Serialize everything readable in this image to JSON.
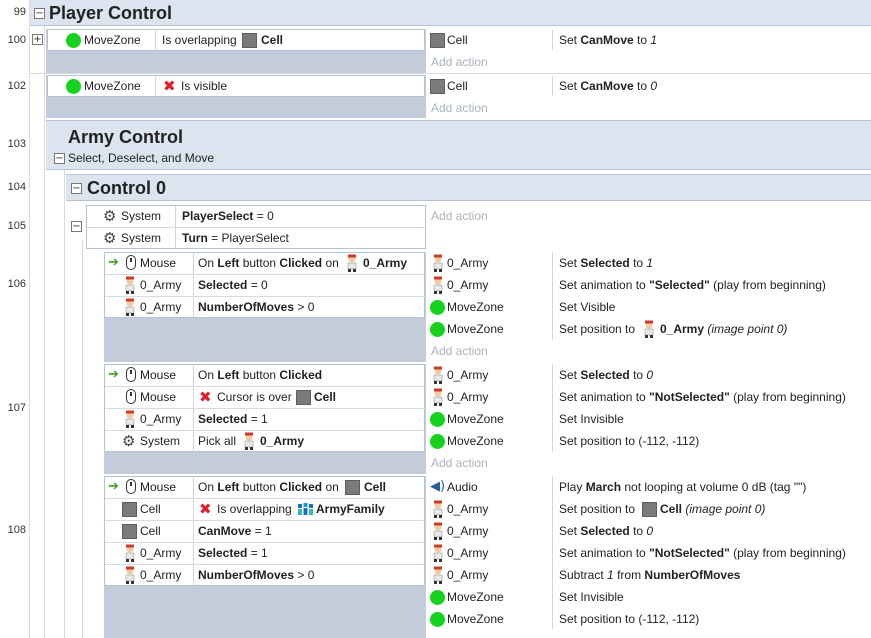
{
  "line_numbers": [
    "99",
    "100",
    "102",
    "103",
    "104",
    "105",
    "106",
    "107",
    "108"
  ],
  "expand_glyphs": {
    "plus": "+",
    "minus": "−"
  },
  "add_action": "Add action",
  "group_player": {
    "title": "Player Control"
  },
  "ev100": {
    "c1_obj": "MoveZone",
    "c1_text": "Is overlapping",
    "c1_target": "Cell",
    "a1_obj": "Cell",
    "a1_pre": "Set",
    "a1_var": "CanMove",
    "a1_mid": "to",
    "a1_val": "1"
  },
  "ev102": {
    "c1_obj": "MoveZone",
    "c1_text": "Is visible",
    "a1_obj": "Cell",
    "a1_pre": "Set",
    "a1_var": "CanMove",
    "a1_mid": "to",
    "a1_val": "0"
  },
  "group_army": {
    "title": "Army Control",
    "description": "Select, Deselect, and Move"
  },
  "group_control0": {
    "title": "Control 0"
  },
  "ev105": {
    "c1_obj": "System",
    "c1_var": "PlayerSelect",
    "c1_rest": "= 0",
    "c2_obj": "System",
    "c2_var": "Turn",
    "c2_rest": "= PlayerSelect"
  },
  "ev106": {
    "c1_obj": "Mouse",
    "c1_pre": "On",
    "c1_btn": "Left",
    "c1_mid": "button",
    "c1_act": "Clicked",
    "c1_on": "on",
    "c1_target": "0_Army",
    "c2_obj": "0_Army",
    "c2_var": "Selected",
    "c2_rest": "= 0",
    "c3_obj": "0_Army",
    "c3_var": "NumberOfMoves",
    "c3_rest": "> 0",
    "a1_obj": "0_Army",
    "a1_pre": "Set",
    "a1_var": "Selected",
    "a1_mid": "to",
    "a1_val": "1",
    "a2_obj": "0_Army",
    "a2_pre": "Set animation to",
    "a2_anim": "\"Selected\"",
    "a2_rest": "(play from beginning)",
    "a3_obj": "MoveZone",
    "a3_text": "Set Visible",
    "a4_obj": "MoveZone",
    "a4_pre": "Set position to",
    "a4_target": "0_Army",
    "a4_rest": "(image point 0)"
  },
  "ev107": {
    "c1_obj": "Mouse",
    "c1_pre": "On",
    "c1_btn": "Left",
    "c1_mid": "button",
    "c1_act": "Clicked",
    "c2_obj": "Mouse",
    "c2_text": "Cursor is over",
    "c2_target": "Cell",
    "c3_obj": "0_Army",
    "c3_var": "Selected",
    "c3_rest": "= 1",
    "c4_obj": "System",
    "c4_text": "Pick all",
    "c4_target": "0_Army",
    "a1_obj": "0_Army",
    "a1_pre": "Set",
    "a1_var": "Selected",
    "a1_mid": "to",
    "a1_val": "0",
    "a2_obj": "0_Army",
    "a2_pre": "Set animation to",
    "a2_anim": "\"NotSelected\"",
    "a2_rest": "(play from beginning)",
    "a3_obj": "MoveZone",
    "a3_text": "Set Invisible",
    "a4_obj": "MoveZone",
    "a4_text": "Set position to (-112, -112)"
  },
  "ev108": {
    "c1_obj": "Mouse",
    "c1_pre": "On",
    "c1_btn": "Left",
    "c1_mid": "button",
    "c1_act": "Clicked",
    "c1_on": "on",
    "c1_target": "Cell",
    "c2_obj": "Cell",
    "c2_text": "Is overlapping",
    "c2_target": "ArmyFamily",
    "c3_obj": "Cell",
    "c3_var": "CanMove",
    "c3_rest": "= 1",
    "c4_obj": "0_Army",
    "c4_var": "Selected",
    "c4_rest": "= 1",
    "c5_obj": "0_Army",
    "c5_var": "NumberOfMoves",
    "c5_rest": "> 0",
    "a1_obj": "Audio",
    "a1_pre": "Play",
    "a1_sound": "March",
    "a1_rest": "not looping at volume 0 dB (tag \"\")",
    "a2_obj": "0_Army",
    "a2_pre": "Set position to",
    "a2_target": "Cell",
    "a2_rest": "(image point 0)",
    "a3_obj": "0_Army",
    "a3_pre": "Set",
    "a3_var": "Selected",
    "a3_mid": "to",
    "a3_val": "0",
    "a4_obj": "0_Army",
    "a4_pre": "Set animation to",
    "a4_anim": "\"NotSelected\"",
    "a4_rest": "(play from beginning)",
    "a5_obj": "0_Army",
    "a5_pre": "Subtract",
    "a5_num": "1",
    "a5_mid": "from",
    "a5_var": "NumberOfMoves",
    "a6_obj": "MoveZone",
    "a6_text": "Set Invisible",
    "a7_obj": "MoveZone",
    "a7_text": "Set position to (-112, -112)"
  }
}
